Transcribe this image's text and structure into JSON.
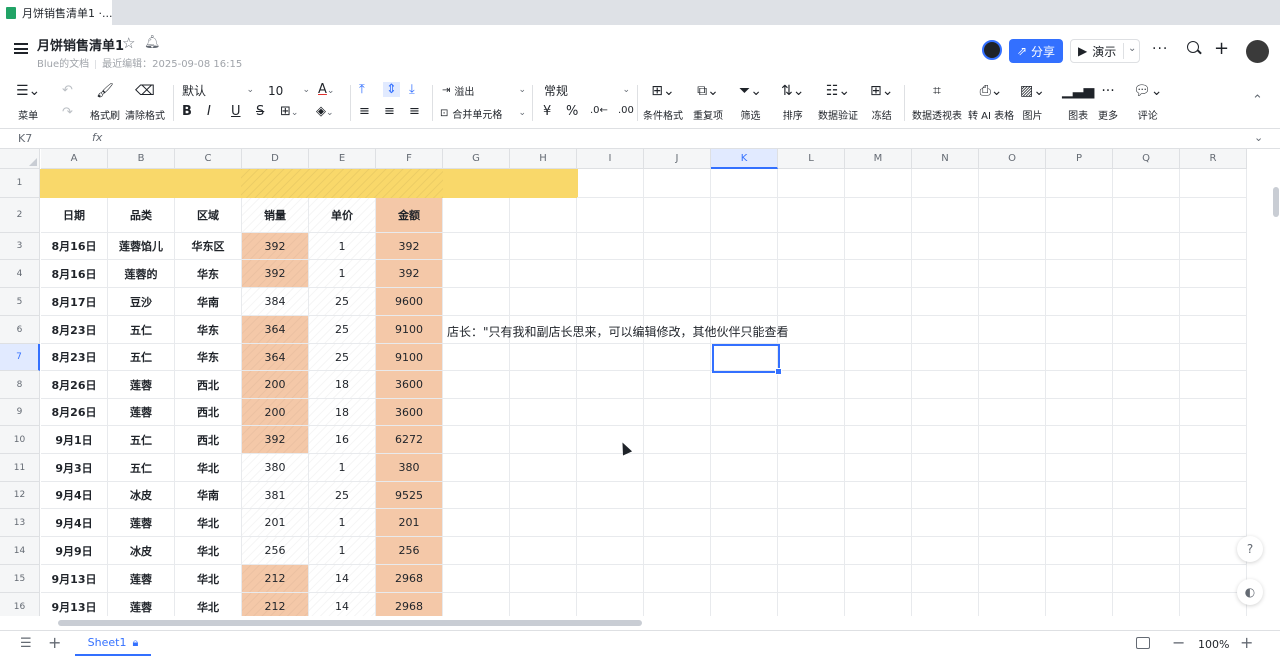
{
  "browser_tab": {
    "title": "月饼销售清单1 ·..."
  },
  "header": {
    "title": "月饼销售清单1",
    "owner": "Blue的文档",
    "last_edit": "最近编辑：2025-09-08 16:15",
    "share_label": "分享",
    "present_label": "演示"
  },
  "toolbar": {
    "menu": "菜单",
    "format_painter": "格式刷",
    "clear_format": "清除格式",
    "font_name": "默认",
    "font_size": "10",
    "overflow": "溢出",
    "merge": "合并单元格",
    "number_format": "常规",
    "conditional_format": "条件格式",
    "duplicates": "重复项",
    "filter": "筛选",
    "sort": "排序",
    "data_validation": "数据验证",
    "freeze": "冻结",
    "pivot": "数据透视表",
    "ai_table": "转 AI 表格",
    "image": "图片",
    "chart": "图表",
    "more": "更多",
    "comment": "评论",
    "currency": "¥",
    "percent": "%"
  },
  "formula_bar": {
    "cell_ref": "K7",
    "fx": "fx"
  },
  "columns": [
    "A",
    "B",
    "C",
    "D",
    "E",
    "F",
    "G",
    "H",
    "I",
    "J",
    "K",
    "L",
    "M",
    "N",
    "O",
    "P",
    "Q",
    "R"
  ],
  "rows": [
    "1",
    "2",
    "3",
    "4",
    "5",
    "6",
    "7",
    "8",
    "9",
    "10",
    "11",
    "12",
    "13",
    "14",
    "15",
    "16"
  ],
  "table": {
    "headers": [
      "日期",
      "品类",
      "区域",
      "销量",
      "单价",
      "金额"
    ],
    "data": [
      [
        "8月16日",
        "莲蓉馅儿",
        "华东区",
        "392",
        "1",
        "392"
      ],
      [
        "8月16日",
        "莲蓉的",
        "华东",
        "392",
        "1",
        "392"
      ],
      [
        "8月17日",
        "豆沙",
        "华南",
        "384",
        "25",
        "9600"
      ],
      [
        "8月23日",
        "五仁",
        "华东",
        "364",
        "25",
        "9100"
      ],
      [
        "8月23日",
        "五仁",
        "华东",
        "364",
        "25",
        "9100"
      ],
      [
        "8月26日",
        "莲蓉",
        "西北",
        "200",
        "18",
        "3600"
      ],
      [
        "8月26日",
        "莲蓉",
        "西北",
        "200",
        "18",
        "3600"
      ],
      [
        "9月1日",
        "五仁",
        "西北",
        "392",
        "16",
        "6272"
      ],
      [
        "9月3日",
        "五仁",
        "华北",
        "380",
        "1",
        "380"
      ],
      [
        "9月4日",
        "冰皮",
        "华南",
        "381",
        "25",
        "9525"
      ],
      [
        "9月4日",
        "莲蓉",
        "华北",
        "201",
        "1",
        "201"
      ],
      [
        "9月9日",
        "冰皮",
        "华北",
        "256",
        "1",
        "256"
      ],
      [
        "9月13日",
        "莲蓉",
        "华北",
        "212",
        "14",
        "2968"
      ],
      [
        "9月13日",
        "莲蓉",
        "华北",
        "212",
        "14",
        "2968"
      ]
    ],
    "orange_d_rows": [
      true,
      true,
      false,
      true,
      true,
      true,
      true,
      true,
      false,
      false,
      false,
      false,
      true,
      true
    ]
  },
  "note": "店长：\"只有我和副店长思来，可以编辑修改，其他伙伴只能查看",
  "footer": {
    "sheet_name": "Sheet1",
    "zoom": "100%"
  },
  "colors": {
    "accent": "#3370ff",
    "band": "#f9d86a",
    "orange": "#f4c8a8"
  }
}
